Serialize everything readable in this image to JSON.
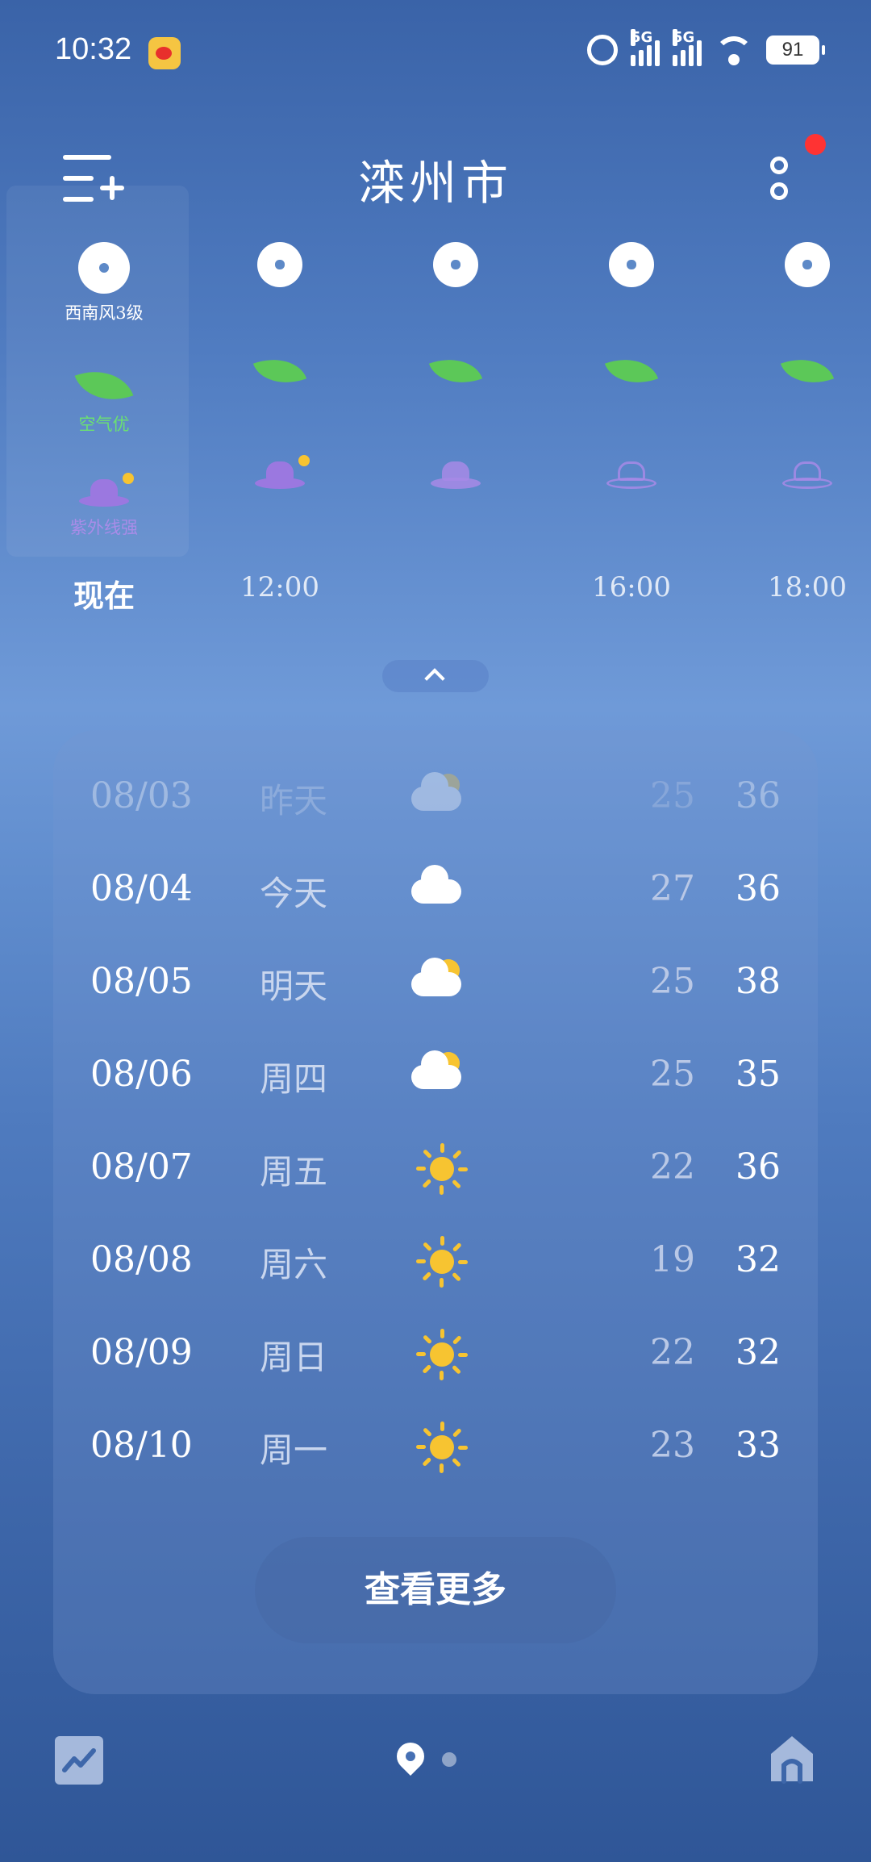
{
  "status_bar": {
    "time": "10:32",
    "network_1": "5G",
    "network_2": "5G",
    "battery": "91"
  },
  "header": {
    "city": "滦州市"
  },
  "hourly": {
    "now_label": "现在",
    "wind_label": "西南风3级",
    "air_label": "空气优",
    "uv_label": "紫外线强",
    "times": [
      "12:00",
      "",
      "16:00",
      "18:00"
    ]
  },
  "forecast": [
    {
      "date": "08/03",
      "day": "昨天",
      "icon": "partly-cloudy-icon",
      "low": "25",
      "high": "36"
    },
    {
      "date": "08/04",
      "day": "今天",
      "icon": "cloud-icon",
      "low": "27",
      "high": "36"
    },
    {
      "date": "08/05",
      "day": "明天",
      "icon": "partly-cloudy-icon",
      "low": "25",
      "high": "38"
    },
    {
      "date": "08/06",
      "day": "周四",
      "icon": "partly-cloudy-icon",
      "low": "25",
      "high": "35"
    },
    {
      "date": "08/07",
      "day": "周五",
      "icon": "sun-icon",
      "low": "22",
      "high": "36"
    },
    {
      "date": "08/08",
      "day": "周六",
      "icon": "sun-icon",
      "low": "19",
      "high": "32"
    },
    {
      "date": "08/09",
      "day": "周日",
      "icon": "sun-icon",
      "low": "22",
      "high": "32"
    },
    {
      "date": "08/10",
      "day": "周一",
      "icon": "sun-icon",
      "low": "23",
      "high": "33"
    }
  ],
  "see_more": "查看更多",
  "colors": {
    "sun": "#f7c431",
    "leaf": "#5cc858",
    "uv_hat": "#9b78e0",
    "notification": "#ff3333"
  }
}
